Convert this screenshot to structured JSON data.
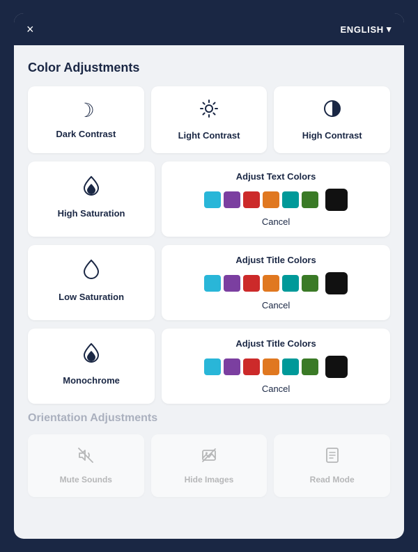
{
  "titlebar": {
    "close_icon": "×",
    "lang_label": "ENGLISH",
    "lang_chevron": "▾"
  },
  "color_section": {
    "title": "Color Adjustments",
    "top_cards": [
      {
        "id": "dark-contrast",
        "icon": "☽",
        "label": "Dark Contrast"
      },
      {
        "id": "light-contrast",
        "icon": "✦",
        "label": "Light Contrast"
      },
      {
        "id": "high-contrast",
        "icon": "◑",
        "label": "High Contrast"
      }
    ],
    "row_cards": [
      {
        "left": {
          "id": "high-saturation",
          "icon": "◈",
          "label": "High Saturation"
        },
        "right": {
          "title": "Adjust Text Colors",
          "swatches": [
            "#29b6d8",
            "#7b3fa0",
            "#cc2a2a",
            "#e07820",
            "#009999",
            "#3a7a26"
          ],
          "cancel": "Cancel"
        }
      },
      {
        "left": {
          "id": "low-saturation",
          "icon": "◇",
          "label": "Low Saturation"
        },
        "right": {
          "title": "Adjust Title Colors",
          "swatches": [
            "#29b6d8",
            "#7b3fa0",
            "#cc2a2a",
            "#e07820",
            "#009999",
            "#3a7a26"
          ],
          "cancel": "Cancel"
        }
      },
      {
        "left": {
          "id": "monochrome",
          "icon": "◈",
          "label": "Monochrome"
        },
        "right": {
          "title": "Adjust Title Colors",
          "swatches": [
            "#29b6d8",
            "#7b3fa0",
            "#cc2a2a",
            "#e07820",
            "#009999",
            "#3a7a26"
          ],
          "cancel": "Cancel"
        }
      }
    ]
  },
  "orientation_section": {
    "title": "Orientation Adjustments",
    "cards": [
      {
        "id": "mute-sounds",
        "icon": "🔇",
        "label": "Mute Sounds"
      },
      {
        "id": "hide-images",
        "icon": "🖼",
        "label": "Hide Images"
      },
      {
        "id": "read-mode",
        "icon": "📄",
        "label": "Read Mode"
      }
    ]
  }
}
